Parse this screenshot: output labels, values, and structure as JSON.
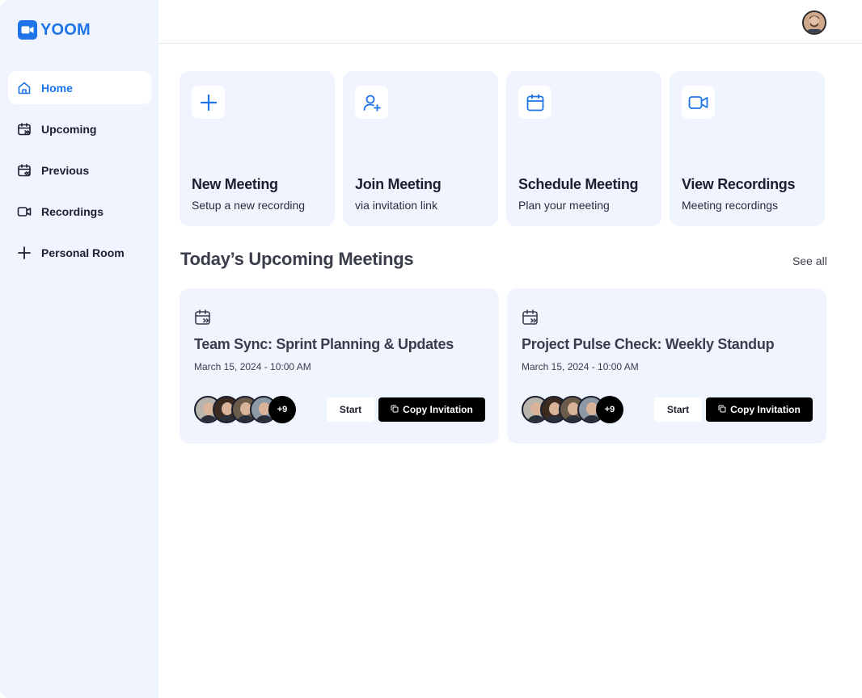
{
  "app": {
    "name": "YOOM",
    "brand_color": "#1e74e8"
  },
  "sidebar": {
    "items": [
      {
        "label": "Home",
        "icon": "home-icon",
        "active": true
      },
      {
        "label": "Upcoming",
        "icon": "calendar-upcoming-icon",
        "active": false
      },
      {
        "label": "Previous",
        "icon": "calendar-previous-icon",
        "active": false
      },
      {
        "label": "Recordings",
        "icon": "video-icon",
        "active": false
      },
      {
        "label": "Personal Room",
        "icon": "plus-icon",
        "active": false
      }
    ]
  },
  "header": {
    "avatar_icon": "user-avatar"
  },
  "actions": [
    {
      "title": "New Meeting",
      "subtitle": "Setup a new recording",
      "icon": "plus-icon"
    },
    {
      "title": "Join Meeting",
      "subtitle": "via invitation link",
      "icon": "user-add-icon"
    },
    {
      "title": "Schedule Meeting",
      "subtitle": "Plan your meeting",
      "icon": "calendar-icon"
    },
    {
      "title": "View Recordings",
      "subtitle": "Meeting recordings",
      "icon": "video-icon"
    }
  ],
  "section": {
    "title": "Today’s Upcoming Meetings",
    "see_all": "See all"
  },
  "meetings": [
    {
      "title": "Team Sync: Sprint Planning & Updates",
      "date": "March 15, 2024 -  10:00 AM",
      "more_count": "+9",
      "start_label": "Start",
      "copy_label": "Copy Invitation"
    },
    {
      "title": "Project Pulse Check: Weekly Standup",
      "date": "March 15, 2024 -  10:00 AM",
      "more_count": "+9",
      "start_label": "Start",
      "copy_label": "Copy Invitation"
    }
  ]
}
